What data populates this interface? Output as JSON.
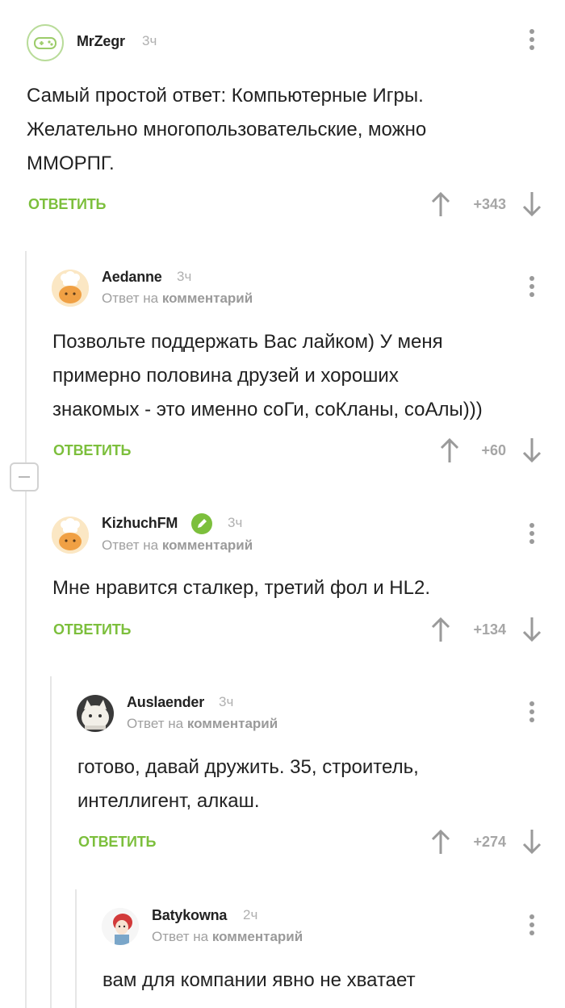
{
  "colors": {
    "accent": "#7cbf3c",
    "muted": "#a6a6a6",
    "text": "#222222"
  },
  "comments": [
    {
      "username": "MrZegr",
      "time": "3ч",
      "avatar": "gamepad-avatar",
      "text_lines": [
        "Самый простой ответ: Компьютерные Игры.",
        "Желательно многопользовательские, можно",
        "ММОРПГ."
      ],
      "reply_label": "ОТВЕТИТЬ",
      "rating": "+343"
    },
    {
      "username": "Aedanne",
      "time": "3ч",
      "avatar": "chef-cat-avatar",
      "reply_to_prefix": "Ответ на",
      "reply_to_link": "комментарий",
      "text_lines": [
        "Позвольте поддержать Вас лайком) У меня",
        "примерно половина друзей и хороших",
        "знакомых - это именно соГи, соКланы, соАлы)))"
      ],
      "reply_label": "ОТВЕТИТЬ",
      "rating": "+60"
    },
    {
      "username": "KizhuchFM",
      "time": "3ч",
      "avatar": "chef-cat-avatar",
      "badge": "pencil-icon",
      "reply_to_prefix": "Ответ на",
      "reply_to_link": "комментарий",
      "text_lines": [
        "Мне нравится сталкер, третий фол и HL2."
      ],
      "reply_label": "ОТВЕТИТЬ",
      "rating": "+134"
    },
    {
      "username": "Auslaender",
      "time": "3ч",
      "avatar": "cat-photo-avatar",
      "reply_to_prefix": "Ответ на",
      "reply_to_link": "комментарий",
      "text_lines": [
        "готово, давай дружить. 35, строитель,",
        "интеллигент, алкаш."
      ],
      "reply_label": "ОТВЕТИТЬ",
      "rating": "+274"
    },
    {
      "username": "Batykowna",
      "time": "2ч",
      "avatar": "girl-drawing-avatar",
      "reply_to_prefix": "Ответ на",
      "reply_to_link": "комментарий",
      "text_lines": [
        "вам для компании явно не хватает"
      ]
    }
  ]
}
